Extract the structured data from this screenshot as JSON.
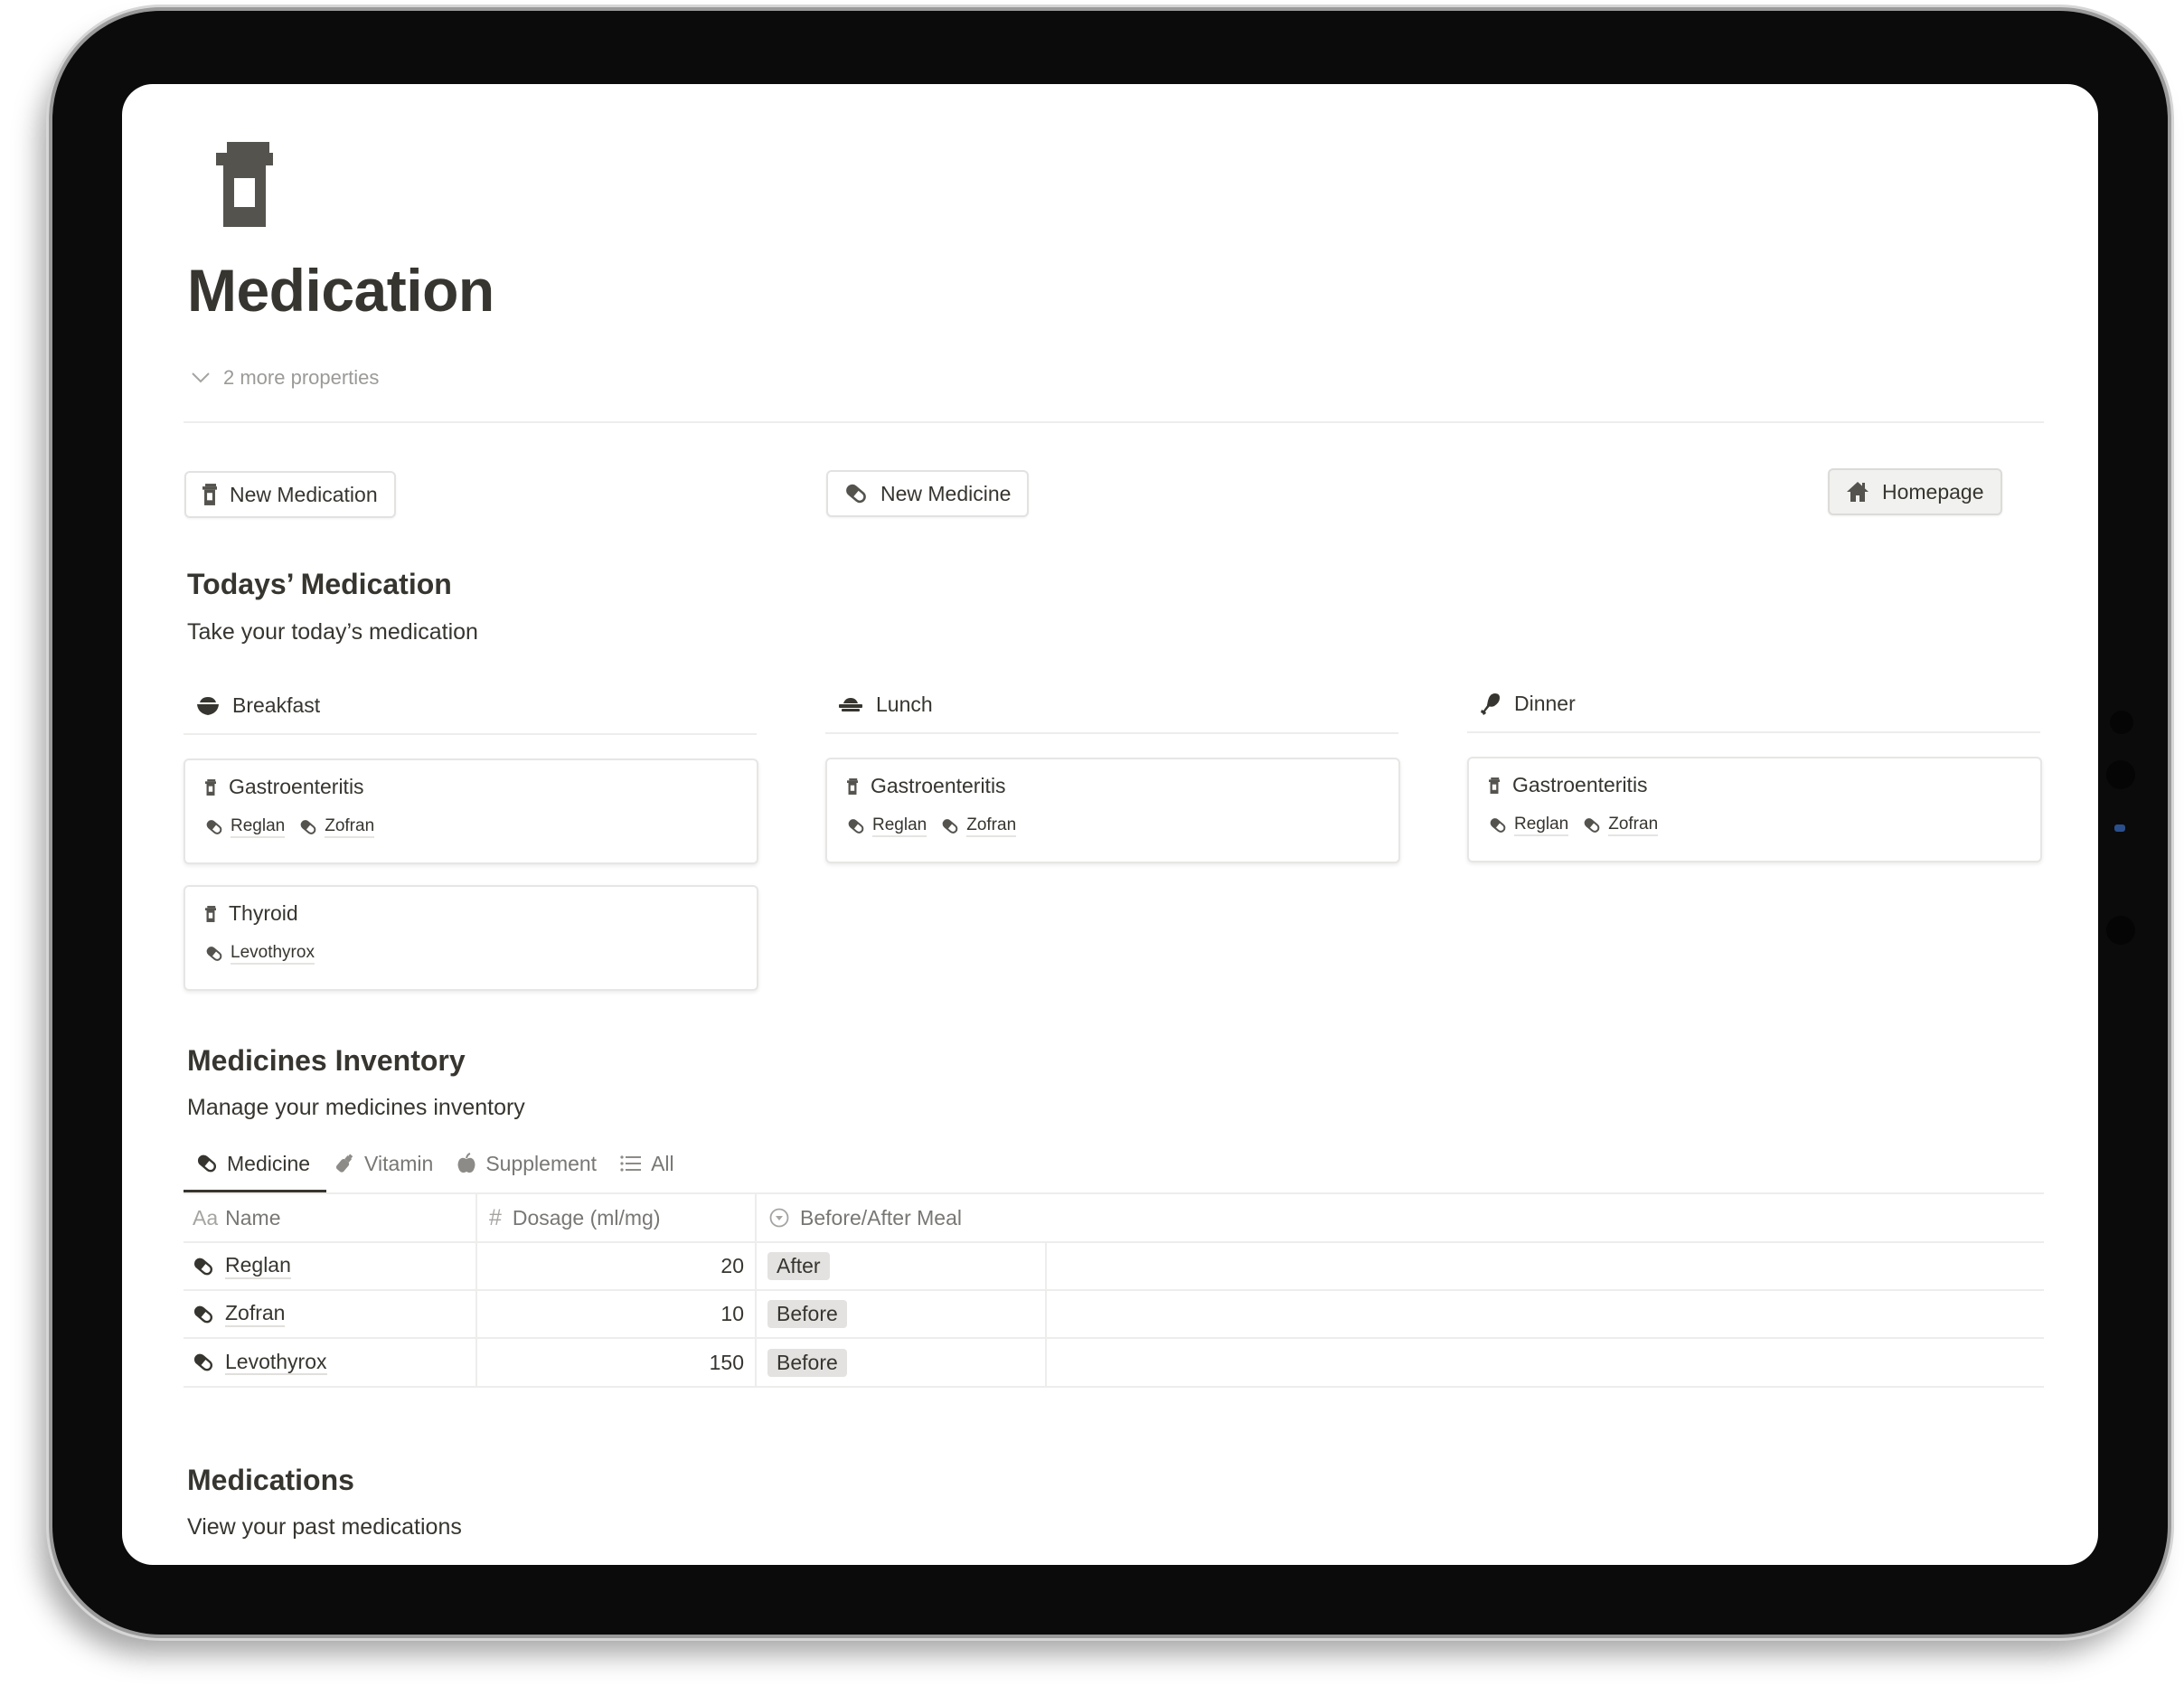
{
  "page": {
    "icon": "pill-bottle-icon",
    "title": "Medication",
    "more_properties": "2 more properties"
  },
  "buttons": {
    "new_medication": {
      "label": "New Medication",
      "icon": "pill-bottle-icon"
    },
    "new_medicine": {
      "label": "New Medicine",
      "icon": "pill-icon"
    },
    "homepage": {
      "label": "Homepage",
      "icon": "house-icon"
    }
  },
  "todays": {
    "heading": "Todays’ Medication",
    "subtitle": "Take your today’s medication",
    "columns": [
      {
        "label": "Breakfast",
        "icon": "bowl-icon",
        "cards": [
          {
            "title": "Gastroenteritis",
            "tags": [
              "Reglan",
              "Zofran"
            ]
          },
          {
            "title": "Thyroid",
            "tags": [
              "Levothyrox"
            ]
          }
        ]
      },
      {
        "label": "Lunch",
        "icon": "lunchbox-icon",
        "cards": [
          {
            "title": "Gastroenteritis",
            "tags": [
              "Reglan",
              "Zofran"
            ]
          }
        ]
      },
      {
        "label": "Dinner",
        "icon": "drumstick-icon",
        "cards": [
          {
            "title": "Gastroenteritis",
            "tags": [
              "Reglan",
              "Zofran"
            ]
          }
        ]
      }
    ]
  },
  "inventory": {
    "heading": "Medicines Inventory",
    "subtitle": "Manage your medicines inventory",
    "tabs": [
      {
        "label": "Medicine",
        "icon": "pill-icon",
        "active": true
      },
      {
        "label": "Vitamin",
        "icon": "vitamin-bottle-icon",
        "active": false
      },
      {
        "label": "Supplement",
        "icon": "apple-icon",
        "active": false
      },
      {
        "label": "All",
        "icon": "list-icon",
        "active": false
      }
    ],
    "columns": [
      {
        "label": "Name",
        "icon_text": "Aa"
      },
      {
        "label": "Dosage (ml/mg)",
        "icon_text": "#"
      },
      {
        "label": "Before/After Meal",
        "icon": "select-icon"
      }
    ],
    "rows": [
      {
        "name": "Reglan",
        "dosage": "20",
        "meal": "After"
      },
      {
        "name": "Zofran",
        "dosage": "10",
        "meal": "Before"
      },
      {
        "name": "Levothyrox",
        "dosage": "150",
        "meal": "Before"
      }
    ]
  },
  "medications": {
    "heading": "Medications",
    "subtitle": "View your past medications"
  },
  "colors": {
    "text": "#37352f",
    "muted": "#787774",
    "border": "#ededec",
    "pill_bg": "#e3e2e0",
    "icon": "#55534e"
  }
}
